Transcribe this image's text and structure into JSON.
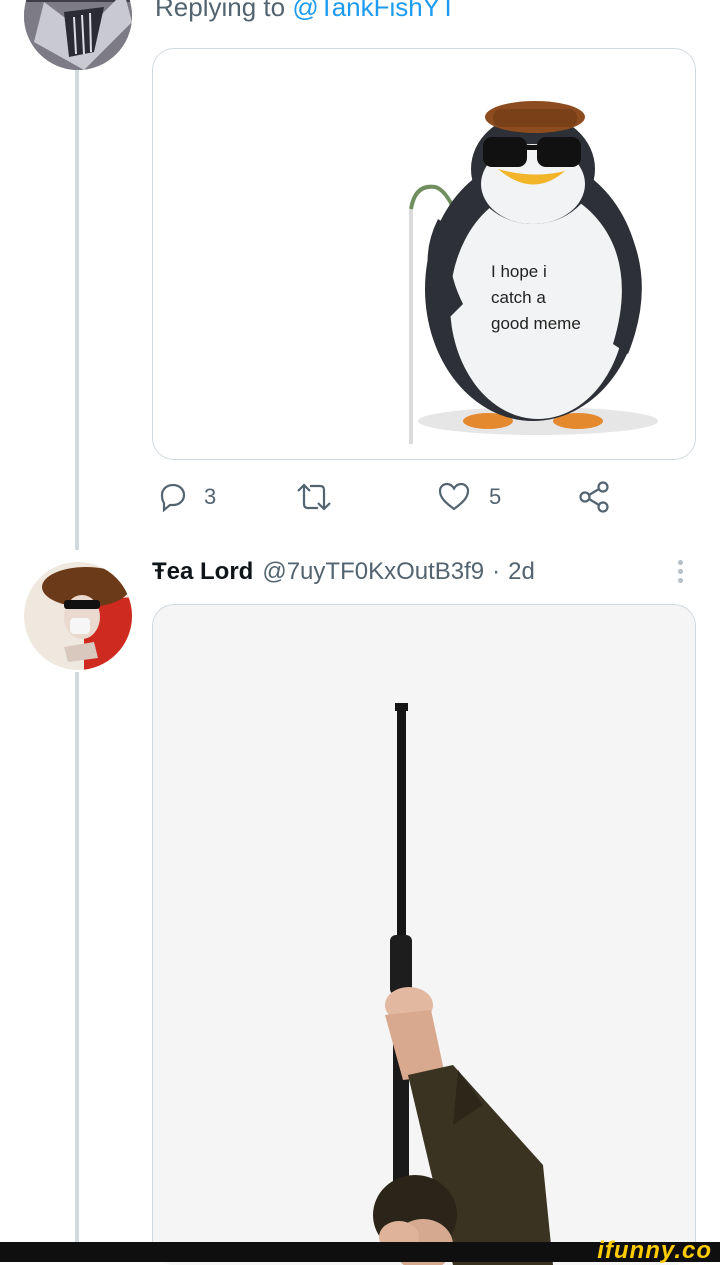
{
  "reply": {
    "prefix": "Replying to ",
    "mention": "@TankFishYT"
  },
  "first_tweet": {
    "image_caption": [
      "I hope i",
      "catch a",
      "good meme"
    ],
    "actions": {
      "reply_count": "3",
      "retweet_count": "",
      "like_count": "5"
    }
  },
  "second_tweet": {
    "display_name": "Ŧea Lord",
    "handle": "@7uyTF0KxOutB3f9",
    "separator": "·",
    "time": "2d"
  },
  "watermark": {
    "brand": "ifunny.co"
  },
  "colors": {
    "accent": "#1d9bf0",
    "secondary_text": "#536471",
    "thread_line": "#cfd9de",
    "brand": "#ffcc00"
  },
  "icons": [
    "reply-icon",
    "retweet-icon",
    "like-icon",
    "share-icon",
    "more-icon"
  ]
}
